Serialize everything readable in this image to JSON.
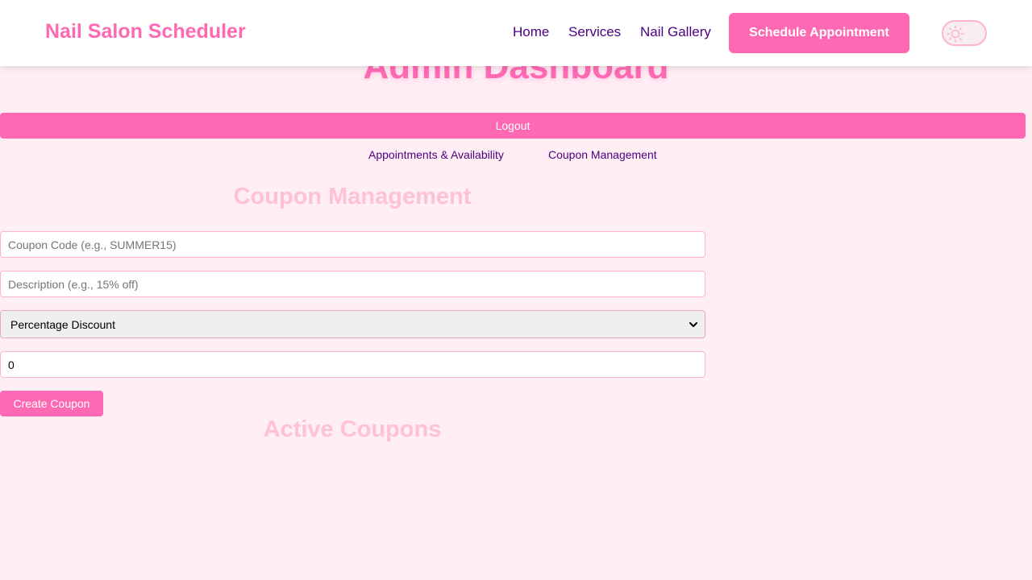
{
  "header": {
    "brand": "Nail Salon Scheduler",
    "nav": [
      "Home",
      "Services",
      "Nail Gallery"
    ],
    "cta": "Schedule Appointment",
    "theme_icon": "sun-icon"
  },
  "dashboard": {
    "title": "Admin Dashboard",
    "logout_label": "Logout",
    "tabs": [
      "Appointments & Availability",
      "Coupon Management"
    ]
  },
  "coupon_form": {
    "title": "Coupon Management",
    "code_placeholder": "Coupon Code (e.g., SUMMER15)",
    "description_placeholder": "Description (e.g., 15% off)",
    "discount_type": "Percentage Discount",
    "discount_value": "0",
    "submit_label": "Create Coupon"
  },
  "active_coupons": {
    "title": "Active Coupons"
  },
  "colors": {
    "accent": "#ff69b4",
    "nav_text": "#4b0082",
    "background": "#ffeef4",
    "section_title": "#ffc2d4"
  }
}
